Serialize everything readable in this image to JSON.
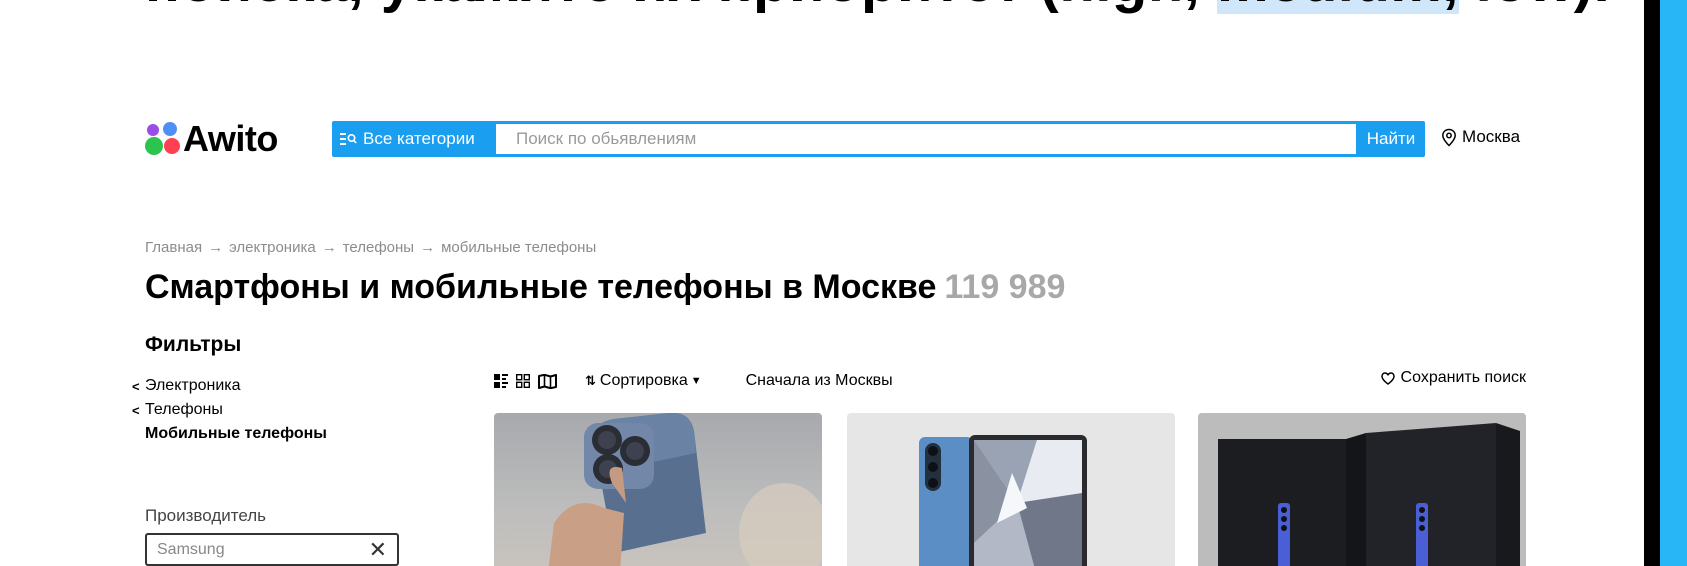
{
  "slide": {
    "title_before": "поиска, укажите их приоритет (high, ",
    "title_highlight": "medium,",
    "title_after": " low)."
  },
  "header": {
    "logo_text": "Awito",
    "categories_label": "Все категории",
    "search_placeholder": "Поиск по обьявлениям",
    "find_label": "Найти",
    "location": "Москва"
  },
  "breadcrumb": [
    "Главная",
    "электроника",
    "телефоны",
    "мобильные телефоны"
  ],
  "breadcrumb_sep": "→",
  "page": {
    "title": "Смартфоны и мобильные телефоны в Москве",
    "count": "119 989"
  },
  "filters": {
    "title": "Фильтры",
    "categories": [
      {
        "label": "Электроника",
        "chevron": "<"
      },
      {
        "label": "Телефоны",
        "chevron": "<"
      },
      {
        "label": "Мобильные телефоны"
      }
    ],
    "maker_label": "Производитель",
    "maker_placeholder": "Samsung",
    "clear_icon": "✕"
  },
  "toolbar": {
    "sort_label": "Сортировка",
    "moscow_first": "Сначала из Москвы",
    "save_search": "Сохранить поиск"
  },
  "colors": {
    "accent": "#1a9ef0",
    "side_strip": "#29b6f6",
    "highlight": "#cfe6fb",
    "count_gray": "#a8a8a8"
  }
}
